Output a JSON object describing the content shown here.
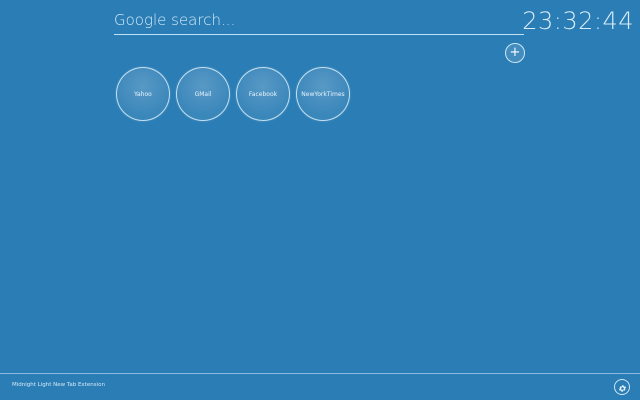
{
  "search": {
    "placeholder": "Google search..."
  },
  "clock": {
    "time": "23:32:44"
  },
  "add_button": {
    "label": "+"
  },
  "tiles": [
    {
      "label": "Yahoo"
    },
    {
      "label": "GMail"
    },
    {
      "label": "Facebook"
    },
    {
      "label": "NewYorkTimes"
    }
  ],
  "footer": {
    "text": "Midnight Light New Tab Extension",
    "settings_icon": "gear-icon"
  },
  "colors": {
    "background": "#2a7db5",
    "foreground": "#d9ecf8"
  }
}
